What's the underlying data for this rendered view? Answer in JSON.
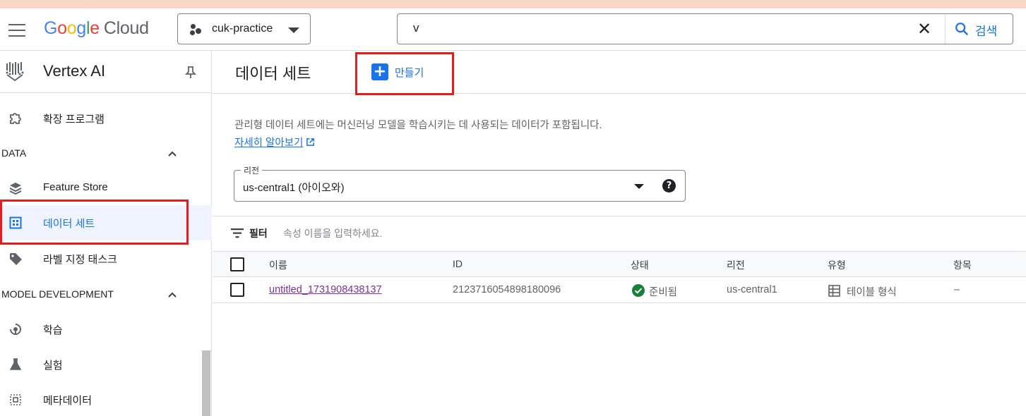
{
  "topbar": {
    "logo_google": "Google",
    "logo_cloud": "Cloud",
    "project_name": "cuk-practice",
    "search_value": "v",
    "search_button": "검색"
  },
  "sidebar": {
    "product_title": "Vertex AI",
    "items_top": [
      {
        "label": "확장 프로그램",
        "icon": "extension-icon"
      }
    ],
    "sections": [
      {
        "label": "DATA",
        "items": [
          {
            "label": "Feature Store",
            "icon": "layers-icon"
          },
          {
            "label": "데이터 세트",
            "icon": "dataset-icon",
            "active": true
          },
          {
            "label": "라벨 지정 태스크",
            "icon": "label-tag-icon"
          }
        ]
      },
      {
        "label": "MODEL DEVELOPMENT",
        "items": [
          {
            "label": "학습",
            "icon": "training-icon"
          },
          {
            "label": "실험",
            "icon": "flask-icon"
          },
          {
            "label": "메타데이터",
            "icon": "metadata-icon"
          }
        ]
      }
    ]
  },
  "main": {
    "title": "데이터 세트",
    "create_label": "만들기",
    "description": "관리형 데이터 세트에는 머신러닝 모델을 학습시키는 데 사용되는 데이터가 포함됩니다.",
    "learn_more": "자세히 알아보기",
    "region": {
      "label": "리전",
      "value": "us-central1 (아이오와)"
    },
    "filter": {
      "label": "필터",
      "placeholder": "속성 이름을 입력하세요."
    },
    "table": {
      "columns": [
        "이름",
        "ID",
        "상태",
        "리전",
        "유형",
        "항목"
      ],
      "rows": [
        {
          "name": "untitled_1731908438137",
          "id": "2123716054898180096",
          "status": "준비됨",
          "region": "us-central1",
          "type": "테이블 형식",
          "items": "–"
        }
      ]
    }
  },
  "colors": {
    "accent": "#1a73e8",
    "highlight_box": "#e02020",
    "status_ok": "#188038"
  }
}
